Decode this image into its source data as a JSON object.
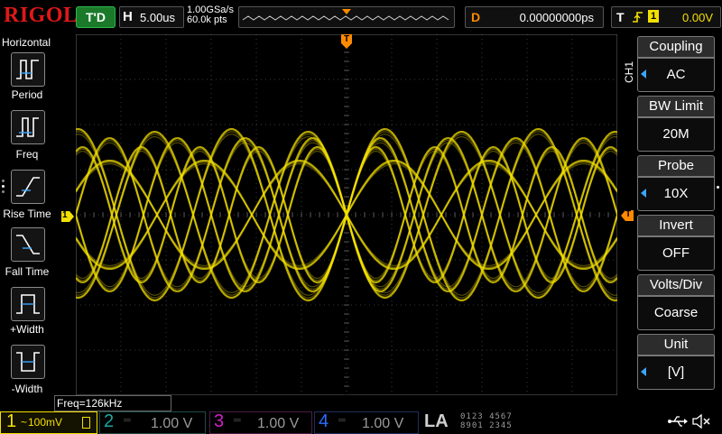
{
  "brand": "RIGOL",
  "trigger_status": "T'D",
  "timebase": {
    "key": "H",
    "value": "5.00us"
  },
  "acquisition": {
    "sample_rate": "1.00GSa/s",
    "memory_depth": "60.0k pts"
  },
  "delay": {
    "key": "D",
    "value": "0.00000000ps"
  },
  "trigger": {
    "key": "T",
    "channel": "1",
    "level": "0.00V"
  },
  "left_menu": {
    "title": "Horizontal",
    "items": [
      {
        "label": "Period"
      },
      {
        "label": "Freq"
      },
      {
        "label": "Rise Time"
      },
      {
        "label": "Fall Time"
      },
      {
        "label": "+Width"
      },
      {
        "label": "-Width"
      }
    ]
  },
  "channel_tag": "CH1",
  "right_menu": {
    "items": [
      {
        "title": "Coupling",
        "value": "AC"
      },
      {
        "title": "BW Limit",
        "value": "20M"
      },
      {
        "title": "Probe",
        "value": "10X"
      },
      {
        "title": "Invert",
        "value": "OFF"
      },
      {
        "title": "Volts/Div",
        "value": "Coarse"
      },
      {
        "title": "Unit",
        "value": "[V]"
      }
    ]
  },
  "markers": {
    "channel1_offset": "1",
    "trigger_level": "T",
    "trigger_position": "T"
  },
  "measurement": "Freq=126kHz",
  "channels": [
    {
      "num": "1",
      "value": "100mV",
      "color": "#f4e000"
    },
    {
      "num": "2",
      "value": "1.00 V",
      "color": "#19a8a0"
    },
    {
      "num": "3",
      "value": "1.00 V",
      "color": "#d020c8"
    },
    {
      "num": "4",
      "value": "1.00 V",
      "color": "#2b6cff"
    }
  ],
  "la": {
    "label": "LA",
    "groups_top": "0123 4567",
    "groups_bottom": "8901 2345"
  },
  "colors": {
    "waveform": "#f4e000",
    "grid": "#3a3a3a",
    "accent": "#ff8a00"
  },
  "icons": [
    "usb-icon",
    "mute-speaker-icon"
  ]
}
